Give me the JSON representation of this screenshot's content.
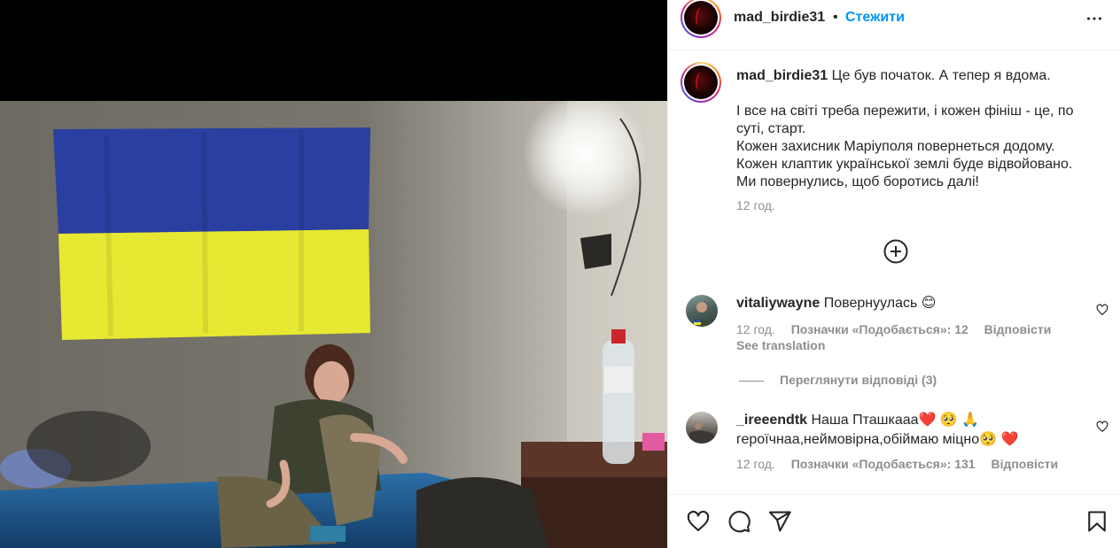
{
  "post": {
    "username": "mad_birdie31",
    "separator": "•",
    "follow_label": "Стежити",
    "more_icon": "more-horizontal-icon"
  },
  "caption": {
    "username": "mad_birdie31",
    "first_line": "Це був початок. А тепер я вдома.",
    "paragraph": [
      "І все на світі треба пережити, і кожен фініш - це, по",
      "суті, старт.",
      "Кожен захисник Маріуполя повернеться додому.",
      "Кожен клаптик української землі буде відвойовано.",
      "Ми повернулись, щоб боротись далі!"
    ],
    "time": "12 год."
  },
  "load_more_icon": "plus-circle-icon",
  "comments": [
    {
      "username": "vitaliywayne",
      "text": "Повернуулась 😊",
      "time": "12 год.",
      "likes": "Позначки «Подобається»: 12",
      "reply": "Відповісти",
      "translate": "See translation"
    },
    {
      "username": "_ireeendtk",
      "text_line1": "Наша Пташкааа❤️ 🥺 🙏",
      "text_line2": "героїчнаа,неймовірна,обіймаю міцно🥺 ❤️",
      "time": "12 год.",
      "likes": "Позначки «Подобається»: 131",
      "reply": "Відповісти"
    }
  ],
  "view_replies": "Переглянути відповіді (3)",
  "actions": {
    "like_icon": "heart-icon",
    "comment_icon": "comment-icon",
    "share_icon": "send-icon",
    "save_icon": "bookmark-icon"
  },
  "colors": {
    "link_blue": "#0095f6",
    "muted": "#8e8e8e",
    "flag_blue": "#2a3fa0",
    "flag_yellow": "#e6e832"
  }
}
